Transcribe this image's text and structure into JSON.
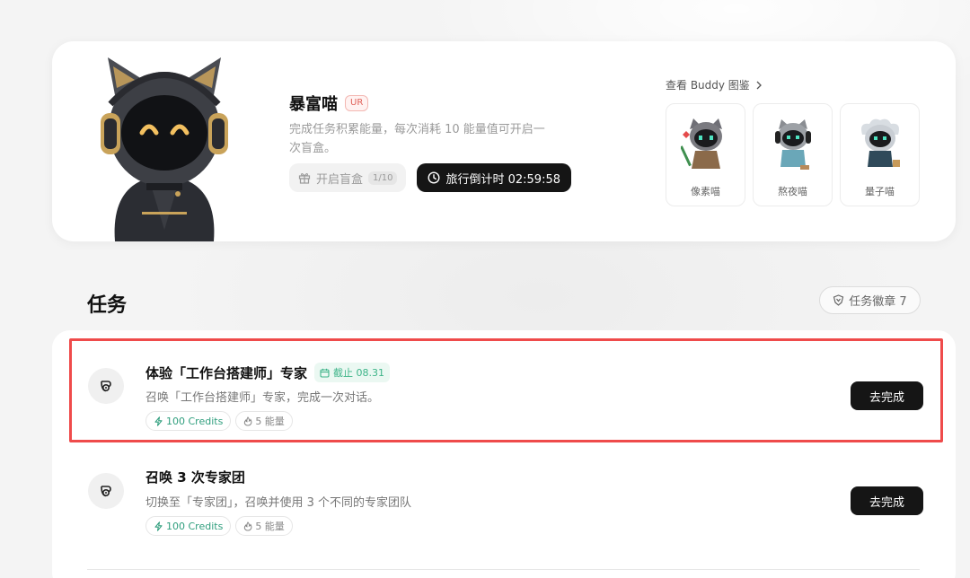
{
  "pet": {
    "name": "暴富喵",
    "rarity": "UR",
    "description": "完成任务积累能量，每次消耗 10 能量值可开启一次盲盒。",
    "open_box_label": "开启盲盒",
    "open_box_count": "1/10",
    "countdown_label": "旅行倒计时 02:59:58"
  },
  "gallery": {
    "link_label": "查看 Buddy 图鉴",
    "buddies": [
      {
        "name": "像素喵"
      },
      {
        "name": "熬夜喵"
      },
      {
        "name": "量子喵"
      }
    ]
  },
  "tasks_section": {
    "title": "任务",
    "badge_label": "任务徽章 7"
  },
  "tasks": [
    {
      "title": "体验「工作台搭建师」专家",
      "deadline": "截止 08.31",
      "description": "召唤「工作台搭建师」专家，完成一次对话。",
      "credits": "100 Credits",
      "energy": "5 能量",
      "action": "去完成"
    },
    {
      "title": "召唤 3 次专家团",
      "deadline": "",
      "description": "切换至「专家团」，召唤并使用 3 个不同的专家团队",
      "credits": "100 Credits",
      "energy": "5 能量",
      "action": "去完成"
    }
  ],
  "colors": {
    "accent_dark": "#151515",
    "credit_green": "#2f9e7d",
    "highlight_red": "#ef4b4b",
    "rarity_red": "#e0625a"
  }
}
